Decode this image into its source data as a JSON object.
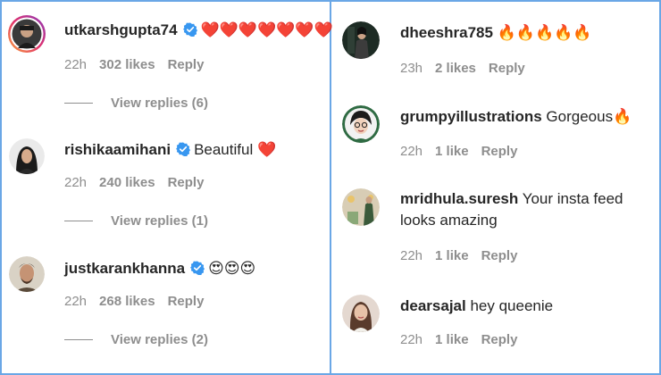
{
  "colors": {
    "frame": "#6aa7e6",
    "verified": "#3897f0",
    "meta": "#8e8e8e"
  },
  "left": [
    {
      "username": "utkarshgupta74",
      "verified": true,
      "text": "❤️❤️❤️❤️❤️❤️❤️",
      "time": "22h",
      "likes": "302 likes",
      "reply": "Reply",
      "view_replies": "View replies (6)",
      "avatar_icon": "avatar-utkarshgupta74"
    },
    {
      "username": "rishikaamihani",
      "verified": true,
      "text": "Beautiful ❤️",
      "time": "22h",
      "likes": "240 likes",
      "reply": "Reply",
      "view_replies": "View replies (1)",
      "avatar_icon": "avatar-rishikaamihani"
    },
    {
      "username": "justkarankhanna",
      "verified": true,
      "text": "😍😍😍",
      "time": "22h",
      "likes": "268 likes",
      "reply": "Reply",
      "view_replies": "View replies (2)",
      "avatar_icon": "avatar-justkarankhanna"
    }
  ],
  "right": [
    {
      "username": "dheeshra785",
      "text": "🔥🔥🔥🔥🔥",
      "time": "23h",
      "likes": "2 likes",
      "reply": "Reply",
      "avatar_icon": "avatar-dheeshra785"
    },
    {
      "username": "grumpyillustrations",
      "text": "Gorgeous🔥",
      "time": "22h",
      "likes": "1 like",
      "reply": "Reply",
      "avatar_icon": "avatar-grumpyillustrations"
    },
    {
      "username": "mridhula.suresh",
      "text": "Your insta feed",
      "text2": "looks amazing",
      "time": "22h",
      "likes": "1 like",
      "reply": "Reply",
      "avatar_icon": "avatar-mridhula-suresh"
    },
    {
      "username": "dearsajal",
      "text": "hey queenie",
      "time": "22h",
      "likes": "1 like",
      "reply": "Reply",
      "avatar_icon": "avatar-dearsajal"
    }
  ]
}
